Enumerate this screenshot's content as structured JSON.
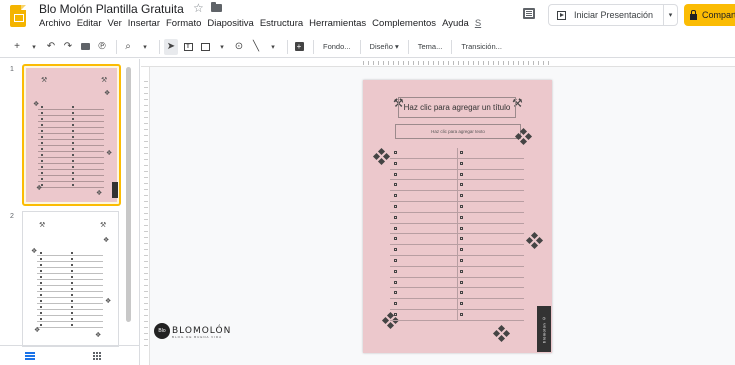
{
  "header": {
    "title": "Blo Molón Plantilla Gratuita",
    "star_icon": "star-outline-icon",
    "folder_icon": "folder-icon",
    "menu": [
      "Archivo",
      "Editar",
      "Ver",
      "Insertar",
      "Formato",
      "Diapositiva",
      "Estructura",
      "Herramientas",
      "Complementos",
      "Ayuda",
      "S"
    ],
    "present_label": "Iniciar Presentación",
    "present_dropdown": "▾",
    "share_label": "Compartir",
    "accent_color": "#fbbc04"
  },
  "toolbar": {
    "add": "+",
    "add_drop": "▾",
    "undo": "↶",
    "redo": "↷",
    "paint": "⚲",
    "zoom": "🔍",
    "zoom_drop": "▾",
    "cursor": "▲",
    "line": "╲",
    "line_drop": "▾",
    "background_label": "Fondo...",
    "layout_label": "Diseño ▾",
    "theme_label": "Tema...",
    "transition_label": "Transición..."
  },
  "filmstrip": {
    "slides": [
      {
        "number": "1",
        "selected": true,
        "bg": "#ecc8cc"
      },
      {
        "number": "2",
        "selected": false,
        "bg": "#ffffff"
      }
    ]
  },
  "slide": {
    "background_color": "#ecc8cc",
    "title_placeholder": "Haz clic para agregar un título",
    "subtitle_placeholder": "Haz clic para agregar texto",
    "side_tab_text": "blomolon ©",
    "list_rows": 16
  },
  "brand": {
    "logo_text": "Blo",
    "name": "BLOMOLÓN",
    "tagline": "BLOG DE BUENA VIDA"
  }
}
